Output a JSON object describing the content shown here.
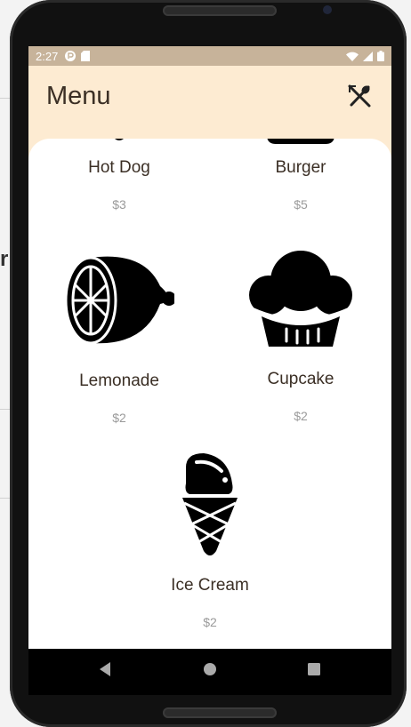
{
  "status": {
    "time": "2:27"
  },
  "appbar": {
    "title": "Menu"
  },
  "menu": [
    {
      "name": "Hot Dog",
      "price": "$3"
    },
    {
      "name": "Burger",
      "price": "$5"
    },
    {
      "name": "Lemonade",
      "price": "$2"
    },
    {
      "name": "Cupcake",
      "price": "$2"
    },
    {
      "name": "Ice Cream",
      "price": "$2"
    }
  ],
  "background": {
    "partial_text": "r"
  },
  "colors": {
    "appbar": "#fdebd2",
    "status": "#c7b39a",
    "text": "#3b2f25",
    "price": "#9a9a9a"
  }
}
